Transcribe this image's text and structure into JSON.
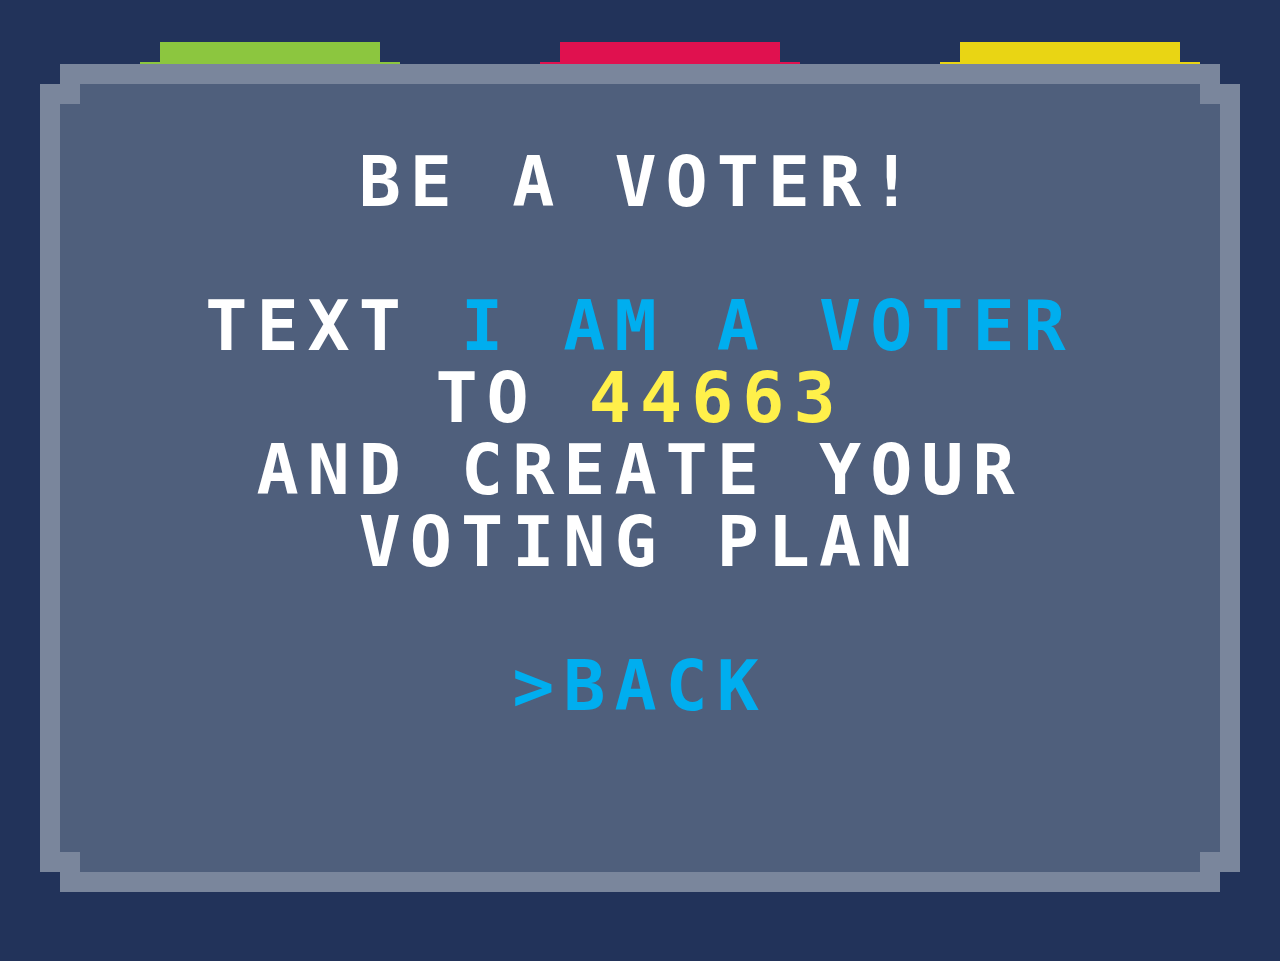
{
  "tabs": [
    {
      "color": "#8cc63f"
    },
    {
      "color": "#e0114f"
    },
    {
      "color": "#e9d514"
    }
  ],
  "title": "BE A VOTER!",
  "message": [
    [
      {
        "text": "TEXT ",
        "kind": "plain"
      },
      {
        "text": "I AM A VOTER",
        "kind": "keyword"
      }
    ],
    [
      {
        "text": "TO ",
        "kind": "plain"
      },
      {
        "text": "44663",
        "kind": "number"
      }
    ],
    [
      {
        "text": "AND CREATE YOUR",
        "kind": "plain"
      }
    ],
    [
      {
        "text": "VOTING PLAN",
        "kind": "plain"
      }
    ]
  ],
  "menu": [
    {
      "cursor": ">",
      "label": "BACK",
      "selected": true
    }
  ]
}
